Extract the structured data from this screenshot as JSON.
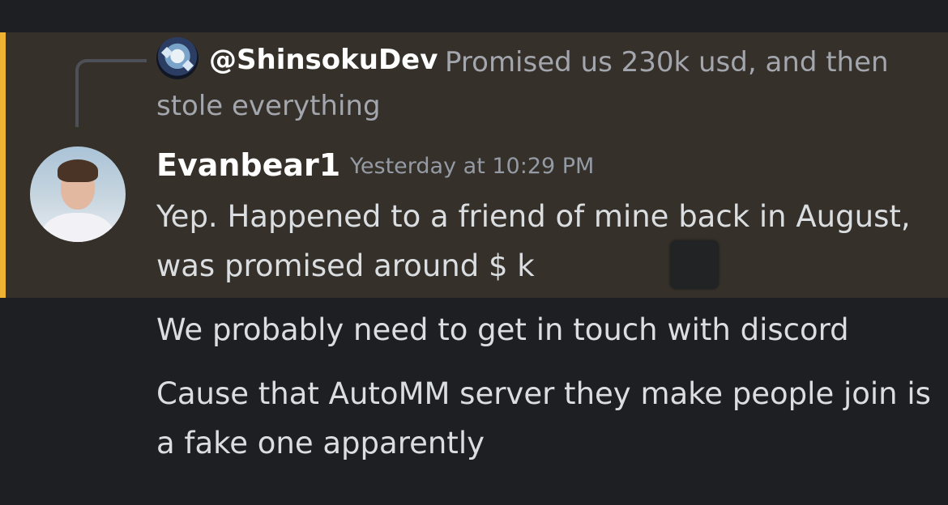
{
  "reply": {
    "author": "@ShinsokuDev",
    "text": "Promised us 230k usd, and then stole everything",
    "avatar_icon": "anime-avatar-icon"
  },
  "message": {
    "author": "Evanbear1",
    "timestamp": "Yesterday at 10:29 PM",
    "avatar_icon": "user-photo-avatar",
    "lines": [
      "Yep. Happened to a friend of mine back in August, was promised around $ k",
      "We probably need to get in touch with discord",
      "Cause that AutoMM server they make people join is a fake one apparently"
    ]
  },
  "colors": {
    "background": "#1e1f22",
    "highlight": "#35302a",
    "accent": "#f0b232",
    "text": "#dbdee1",
    "muted": "#949ba4"
  }
}
